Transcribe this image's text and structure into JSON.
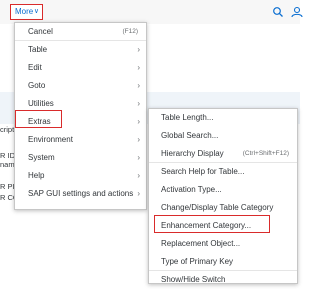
{
  "toolbar": {
    "more_label": "More"
  },
  "background_text": [
    "cript",
    "R ID",
    "nam",
    "R PI",
    "R COUNTRY"
  ],
  "more_menu": [
    {
      "label": "Cancel",
      "shortcut": "(F12)"
    },
    {
      "label": "Table"
    },
    {
      "label": "Edit"
    },
    {
      "label": "Goto"
    },
    {
      "label": "Utilities"
    },
    {
      "label": "Extras"
    },
    {
      "label": "Environment"
    },
    {
      "label": "System"
    },
    {
      "label": "Help"
    },
    {
      "label": "SAP GUI settings and actions"
    }
  ],
  "extras_menu": [
    {
      "label": "Table Length..."
    },
    {
      "label": "Global Search..."
    },
    {
      "label": "Hierarchy Display",
      "shortcut": "(Ctrl+Shift+F12)"
    },
    {
      "label": "Search Help for Table..."
    },
    {
      "label": "Activation Type..."
    },
    {
      "label": "Change/Display Table Category"
    },
    {
      "label": "Enhancement Category..."
    },
    {
      "label": "Replacement Object..."
    },
    {
      "label": "Type of Primary Key"
    },
    {
      "label": "Show/Hide Switch"
    }
  ],
  "accent_color": "#0a6ed1",
  "highlight_color": "#d92b2b"
}
